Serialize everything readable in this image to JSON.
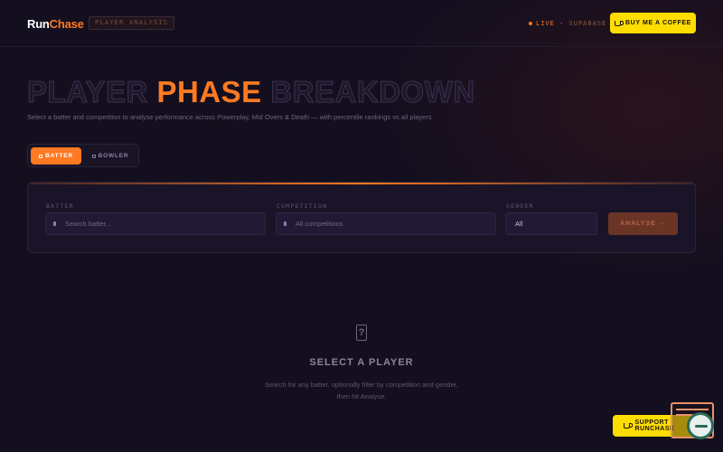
{
  "header": {
    "logo_run": "Run",
    "logo_chase": "Chase",
    "page_tag": "PLAYER ANALYSIS",
    "live_label": "LIVE",
    "live_separator": "·",
    "live_source": "SUPABASE",
    "coffee_button": "BUY ME A COFFEE"
  },
  "hero": {
    "title_word1": "PLAYER",
    "title_word2": "PHASE",
    "title_word3": "BREAKDOWN",
    "subtitle": "Select a batter and competition to analyse performance across Powerplay, Mid Overs & Death — with percentile rankings vs all players"
  },
  "toggle": {
    "batter": "BATTER",
    "bowler": "BOWLER",
    "active": "batter"
  },
  "filters": {
    "batter_label": "BATTER",
    "batter_placeholder": "Search batter...",
    "competition_label": "COMPETITION",
    "competition_placeholder": "All competitions",
    "gender_label": "GENDER",
    "gender_value": "All",
    "analyse_button": "ANALYSE →"
  },
  "empty_state": {
    "icon": "?",
    "title": "SELECT A PLAYER",
    "description": "Search for any batter, optionally filter by competition and gender, then hit Analyse."
  },
  "support": {
    "label": "SUPPORT RUNCHASE"
  },
  "colors": {
    "accent": "#ff7a22",
    "yellow": "#ffdd00",
    "background": "#140f1f"
  }
}
